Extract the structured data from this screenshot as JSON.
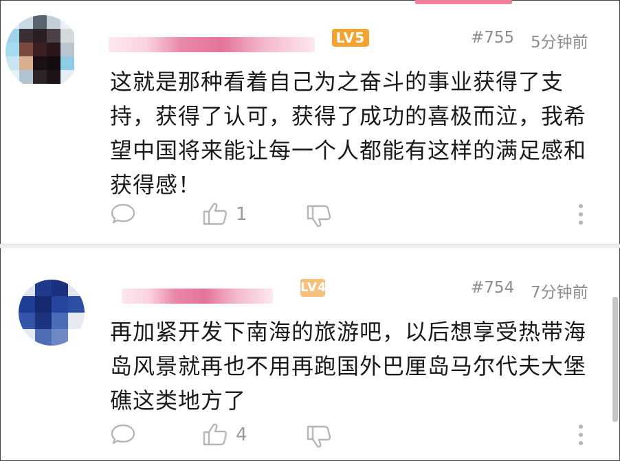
{
  "comments": [
    {
      "level": "LV5",
      "floor": "#755",
      "time": "5分钟前",
      "content": "这就是那种看着自己为之奋斗的事业获得了支持，获得了认可，获得了成功的喜极而泣，我希望中国将来能让每一个人都能有这样的满足感和获得感！",
      "likes": "1"
    },
    {
      "level": "LV4",
      "floor": "#754",
      "time": "7分钟前",
      "content": "再加紧开发下南海的旅游吧，以后想享受热带海岛风景就再也不用再跑国外巴厘岛马尔代夫大堡礁这类地方了",
      "likes": "4"
    }
  ],
  "colors": {
    "level5": "#f2a431",
    "level4": "#f6c07c",
    "meta": "#8c8c8c",
    "icon": "#b5b5b5",
    "accent": "#f0809a"
  },
  "icons": [
    "comment-icon",
    "thumbs-up-icon",
    "thumbs-down-icon",
    "more-vertical-icon"
  ]
}
